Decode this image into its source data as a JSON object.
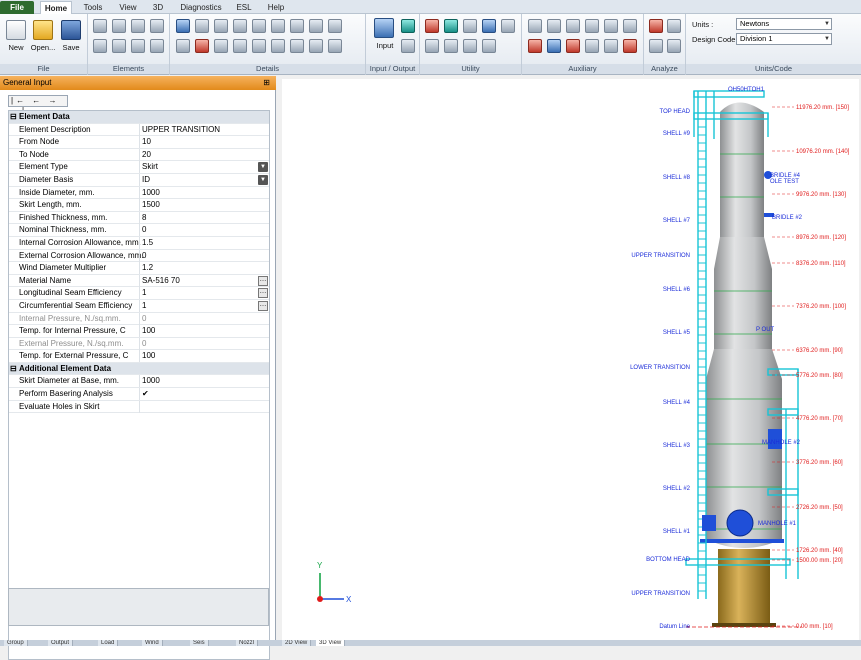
{
  "menu": {
    "tabs": [
      {
        "label": "File"
      },
      {
        "label": "Home"
      },
      {
        "label": "Tools"
      },
      {
        "label": "View"
      },
      {
        "label": "3D"
      },
      {
        "label": "Diagnostics"
      },
      {
        "label": "ESL"
      },
      {
        "label": "Help"
      }
    ]
  },
  "ribbon": {
    "file_group": {
      "label": "File",
      "new": "New",
      "open": "Open...",
      "save": "Save"
    },
    "elements_group": {
      "label": "Elements"
    },
    "details_group": {
      "label": "Details"
    },
    "io_group": {
      "label": "Input / Output",
      "input": "Input"
    },
    "utility_group": {
      "label": "Utility"
    },
    "auxiliary_group": {
      "label": "Auxiliary"
    },
    "analyze_group": {
      "label": "Analyze"
    },
    "units_group": {
      "label": "Units/Code",
      "units_label": "Units :",
      "units_value": "Newtons",
      "design_code_label": "Design Code :",
      "design_code_value": "Division 1"
    }
  },
  "panel": {
    "title": "General Input",
    "nav_icons": "|← ← → →|",
    "sections": [
      {
        "title": "Element Data",
        "rows": [
          {
            "label": "Element Description",
            "value": "UPPER TRANSITION"
          },
          {
            "label": "From Node",
            "value": "10"
          },
          {
            "label": "To Node",
            "value": "20"
          },
          {
            "label": "Element Type",
            "value": "Skirt"
          },
          {
            "label": "Diameter Basis",
            "value": "ID"
          },
          {
            "label": "Inside Diameter, mm.",
            "value": "1000"
          },
          {
            "label": "Skirt Length, mm.",
            "value": "1500"
          },
          {
            "label": "Finished Thickness, mm.",
            "value": "8"
          },
          {
            "label": "Nominal Thickness, mm.",
            "value": "0"
          },
          {
            "label": "Internal Corrosion Allowance, mm.",
            "value": "1.5"
          },
          {
            "label": "External Corrosion Allowance, mm.",
            "value": "0"
          },
          {
            "label": "Wind Diameter Multiplier",
            "value": "1.2"
          },
          {
            "label": "Material Name",
            "value": "SA-516 70"
          },
          {
            "label": "Longitudinal Seam Efficiency",
            "value": "1"
          },
          {
            "label": "Circumferential Seam Efficiency",
            "value": "1"
          },
          {
            "label": "Internal Pressure, N./sq.mm.",
            "value": "0"
          },
          {
            "label": "Temp. for Internal Pressure, C",
            "value": "100"
          },
          {
            "label": "External Pressure, N./sq.mm.",
            "value": "0"
          },
          {
            "label": "Temp. for External Pressure, C",
            "value": "100"
          }
        ]
      },
      {
        "title": "Additional Element Data",
        "rows": [
          {
            "label": "Skirt Diameter at Base, mm.",
            "value": "1000"
          },
          {
            "label": "Perform Basering Analysis",
            "value": "✔"
          },
          {
            "label": "Evaluate Holes in Skirt",
            "value": ""
          }
        ]
      }
    ]
  },
  "bottom_tabs": [
    {
      "label": "Group"
    },
    {
      "label": "Output"
    },
    {
      "label": "Load"
    },
    {
      "label": "Wind"
    },
    {
      "label": "Seis"
    },
    {
      "label": "Nozzl"
    },
    {
      "label": "2D View"
    },
    {
      "label": "3D View"
    }
  ],
  "view3d": {
    "left_labels": [
      {
        "text": "TOP HEAD"
      },
      {
        "text": "SHELL #9"
      },
      {
        "text": "SHELL #8"
      },
      {
        "text": "SHELL #7"
      },
      {
        "text": "UPPER TRANSITION"
      },
      {
        "text": "SHELL #6"
      },
      {
        "text": "SHELL #5"
      },
      {
        "text": "LOWER TRANSITION"
      },
      {
        "text": "SHELL #4"
      },
      {
        "text": "SHELL #3"
      },
      {
        "text": "SHELL #2"
      },
      {
        "text": "SHELL #1"
      },
      {
        "text": "BOTTOM HEAD"
      },
      {
        "text": "UPPER TRANSITION"
      },
      {
        "text": "Datum Line"
      }
    ],
    "right_labels": [
      {
        "text": "11976.20 mm.  [150]"
      },
      {
        "text": "10976.20 mm.  [140]"
      },
      {
        "text": "9976.20 mm.  [130]"
      },
      {
        "text": "8976.20 mm.  [120]"
      },
      {
        "text": "8376.20 mm.  [110]"
      },
      {
        "text": "7376.20 mm.  [100]"
      },
      {
        "text": "6376.20 mm.  [90]"
      },
      {
        "text": "5776.20 mm.  [80]"
      },
      {
        "text": "4776.20 mm.  [70]"
      },
      {
        "text": "3776.20 mm.  [60]"
      },
      {
        "text": "2726.20 mm.  [50]"
      },
      {
        "text": "1726.20 mm.  [40]"
      },
      {
        "text": "1500.00 mm.  [20]"
      },
      {
        "text": "0.00 mm.  [10]"
      }
    ],
    "nozzle_labels": [
      {
        "text": "OH50HTOH1"
      },
      {
        "text": "BRIDLE #4"
      },
      {
        "text": "OLE TEST"
      },
      {
        "text": "BRIDLE #2"
      },
      {
        "text": "P OUT"
      },
      {
        "text": "MANHOLE #2"
      },
      {
        "text": "MANHOLE #1"
      }
    ],
    "axes": {
      "x": "X",
      "y": "Y"
    }
  }
}
